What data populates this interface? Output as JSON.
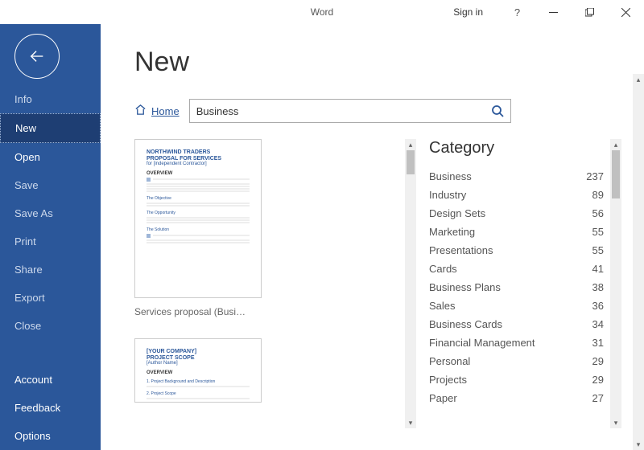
{
  "titlebar": {
    "app_title": "Word",
    "signin": "Sign in",
    "help": "?"
  },
  "sidebar": {
    "items": [
      "Info",
      "New",
      "Open",
      "Save",
      "Save As",
      "Print",
      "Share",
      "Export",
      "Close"
    ],
    "selected_index": 1,
    "bottom_items": [
      "Account",
      "Feedback",
      "Options"
    ]
  },
  "page": {
    "title": "New",
    "breadcrumb_home": "Home"
  },
  "search": {
    "value": "Business"
  },
  "templates": [
    {
      "title_line1": "NORTHWIND TRADERS",
      "title_line2": "PROPOSAL FOR SERVICES",
      "subline": "for [independent Contractor]",
      "overview": "OVERVIEW",
      "caption": "Services proposal (Busi…"
    },
    {
      "title_line1": "[YOUR COMPANY]",
      "title_line2": "PROJECT SCOPE",
      "subline": "[Author Name]",
      "overview": "OVERVIEW",
      "caption": ""
    }
  ],
  "category": {
    "title": "Category",
    "items": [
      {
        "name": "Business",
        "count": 237
      },
      {
        "name": "Industry",
        "count": 89
      },
      {
        "name": "Design Sets",
        "count": 56
      },
      {
        "name": "Marketing",
        "count": 55
      },
      {
        "name": "Presentations",
        "count": 55
      },
      {
        "name": "Cards",
        "count": 41
      },
      {
        "name": "Business Plans",
        "count": 38
      },
      {
        "name": "Sales",
        "count": 36
      },
      {
        "name": "Business Cards",
        "count": 34
      },
      {
        "name": "Financial Management",
        "count": 31
      },
      {
        "name": "Personal",
        "count": 29
      },
      {
        "name": "Projects",
        "count": 29
      },
      {
        "name": "Paper",
        "count": 27
      }
    ]
  }
}
